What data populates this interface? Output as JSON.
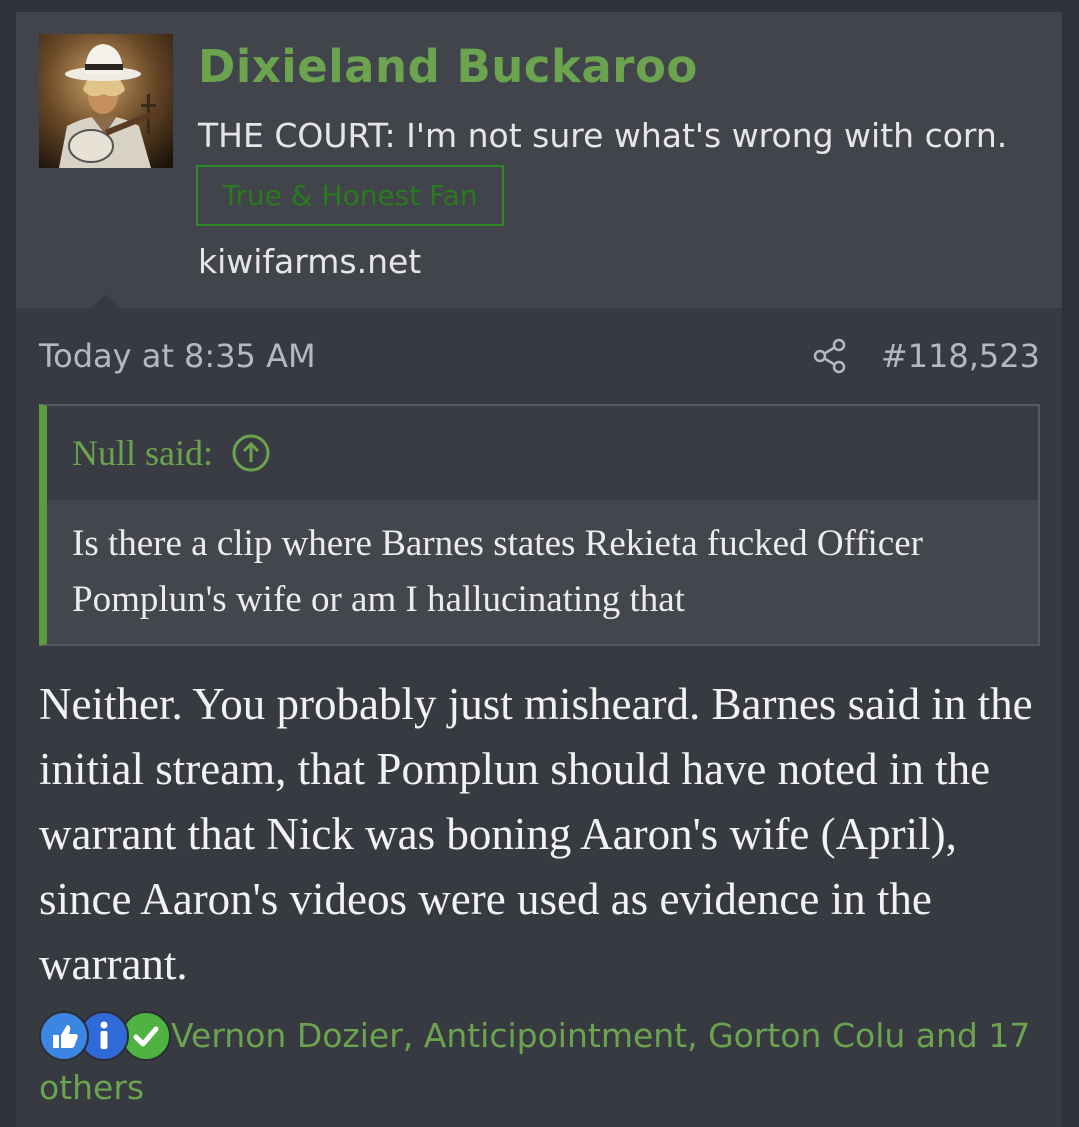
{
  "user": {
    "name": "Dixieland Buckaroo",
    "title": "THE COURT: I'm not sure what's wrong with corn.",
    "banner": "True & Honest Fan",
    "site": "kiwifarms.net"
  },
  "post": {
    "date": "Today at 8:35 AM",
    "number": "#118,523",
    "quote": {
      "author_label": "Null said:",
      "text": "Is there a clip where Barnes states Rekieta fucked Officer Pomplun's wife or am I hallucinating that"
    },
    "message": "Neither. You probably just misheard. Barnes said in the initial stream, that Pomplun should have noted in the warrant that Nick was boning Aaron's wife (April), since Aaron's videos were used as evidence in the warrant."
  },
  "reactions": {
    "icons": [
      "like-icon",
      "informative-icon",
      "checkmark-icon"
    ],
    "text": "Vernon Dozier, Anticipointment, Gorton Colu and 17 others"
  },
  "colors": {
    "accent_green": "#6ba34f",
    "banner_green": "#2d8a24",
    "background": "#2f3238",
    "post_bg": "#373a40",
    "header_bg": "#41444a"
  }
}
